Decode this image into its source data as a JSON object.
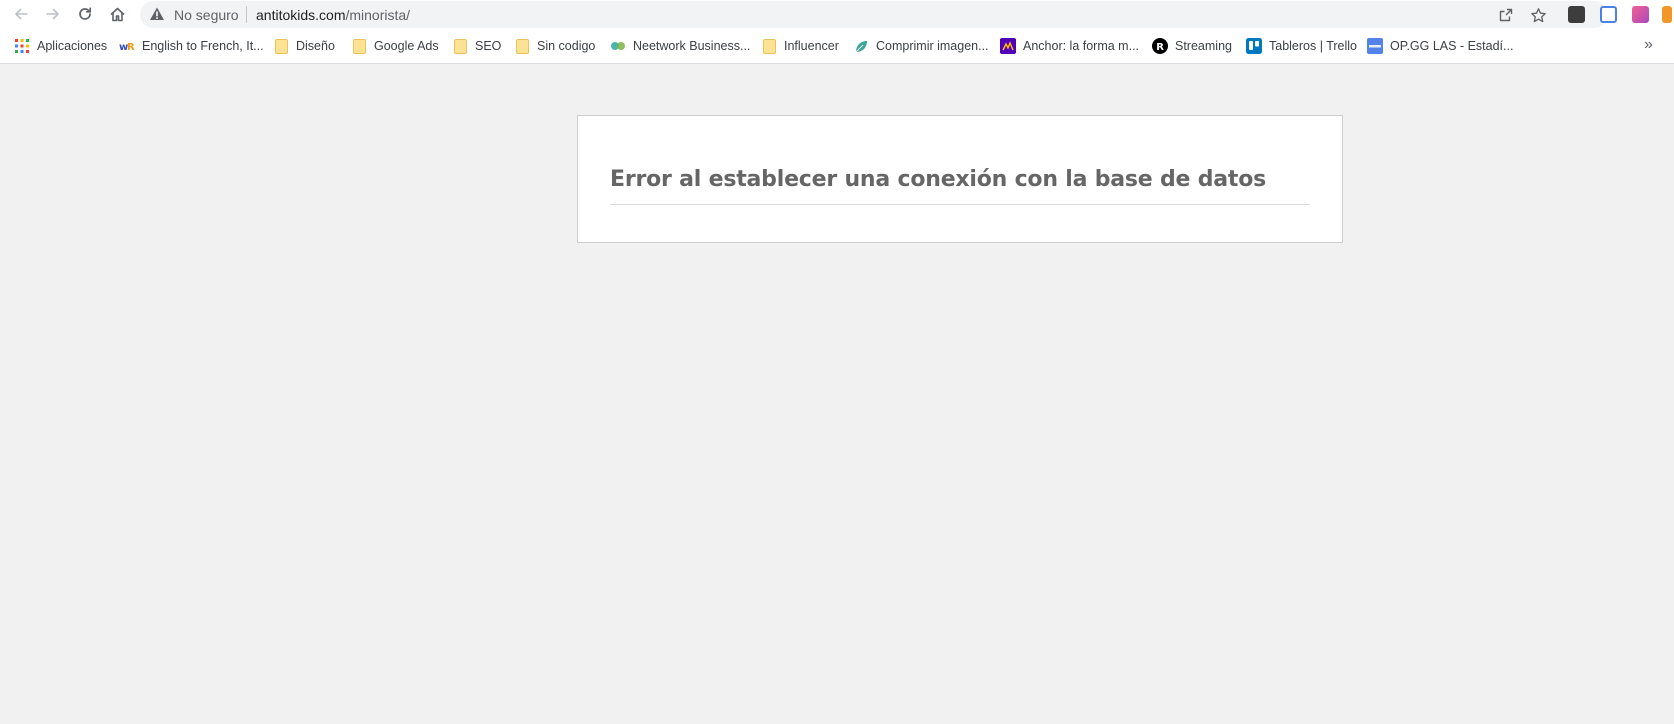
{
  "browser": {
    "security_label": "No seguro",
    "url_host": "antitokids.com",
    "url_path": "/minorista/",
    "extensions": [
      "flow",
      "bookmark-blue",
      "pink-gradient",
      "orange-bar"
    ]
  },
  "bookmarks": {
    "items": [
      {
        "label": "Aplicaciones",
        "icon": "apps-grid-icon"
      },
      {
        "label": "English to French, It...",
        "icon": "wordreference-icon"
      },
      {
        "label": "Diseño",
        "icon": "folder-icon"
      },
      {
        "label": "Google Ads",
        "icon": "folder-icon"
      },
      {
        "label": "SEO",
        "icon": "folder-icon"
      },
      {
        "label": "Sin codigo",
        "icon": "folder-icon"
      },
      {
        "label": "Neetwork Business...",
        "icon": "neetwork-icon"
      },
      {
        "label": "Influencer",
        "icon": "folder-icon"
      },
      {
        "label": "Comprimir imagen...",
        "icon": "leaf-icon"
      },
      {
        "label": "Anchor: la forma m...",
        "icon": "anchor-icon"
      },
      {
        "label": "Streaming",
        "icon": "r-logo-icon"
      },
      {
        "label": "Tableros | Trello",
        "icon": "trello-icon"
      },
      {
        "label": "OP.GG LAS - Estadí...",
        "icon": "opgg-icon"
      }
    ],
    "more": "»"
  },
  "page": {
    "error_message": "Error al establecer una conexión con la base de datos"
  },
  "colors": {
    "page_background": "#f1f1f1",
    "box_background": "#ffffff",
    "title_color": "#666666"
  }
}
